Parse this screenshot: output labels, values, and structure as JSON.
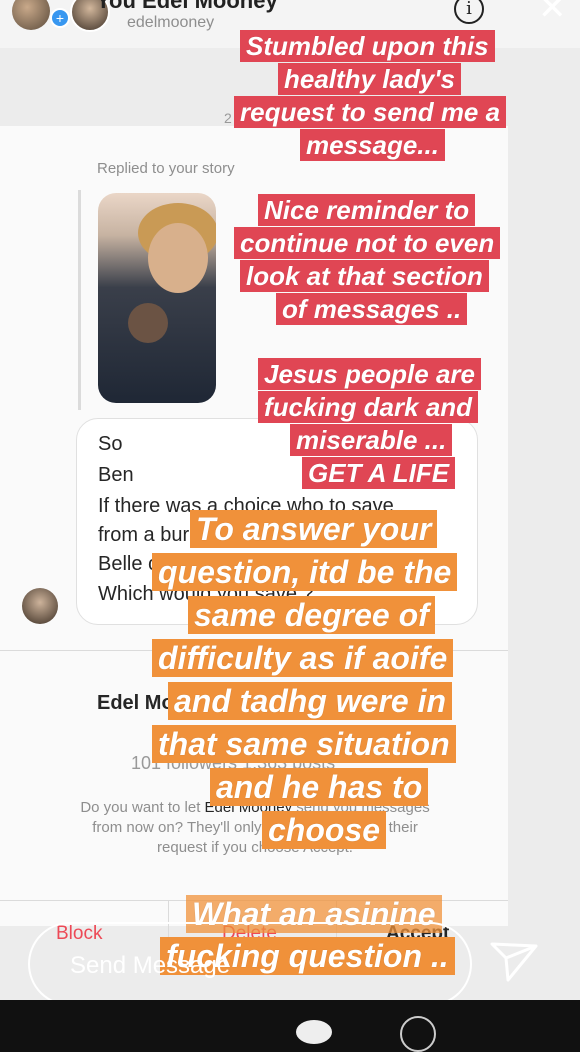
{
  "header": {
    "title": "You Edel Mooney",
    "handle": "edelmooney"
  },
  "dm": {
    "timestamp": "2",
    "replied_label": "Replied to your story",
    "message_lines": [
      "So",
      "Ben",
      "If there was a choice who to save",
      "from a bur",
      "Belle c",
      "Which would you save ?"
    ],
    "sender_name": "Edel Mo",
    "stats": "101 followers 1,363 posts",
    "prompt_line1_a": "Do you want to let ",
    "prompt_line1_name": "Edel Mooney",
    "prompt_line1_b": " send you messages",
    "prompt_line2": "from now on? They'll only know you've seen their",
    "prompt_line3": "request if you choose Accept.",
    "actions": {
      "block": "Block",
      "delete": "Delete",
      "accept": "Accept"
    }
  },
  "captions": {
    "red": [
      "Stumbled upon this",
      "healthy lady's",
      "request to send me a",
      "message...",
      "Nice reminder to",
      "continue not to even",
      "look at that section",
      "of messages ..",
      "Jesus people are",
      "fucking dark and",
      "miserable ...",
      "GET A LIFE"
    ],
    "orange": [
      "To answer your",
      "question, itd be the",
      "same degree of",
      "difficulty as if aoife",
      "and tadhg were in",
      "that same situation",
      "and he has to",
      "choose",
      "What an asinine",
      "fucking question .."
    ]
  },
  "reply": {
    "placeholder": "Send Message"
  },
  "colors": {
    "caption_red": "#e04654",
    "caption_orange": "#f0913a",
    "block_red": "#ed4956"
  },
  "icons": [
    "plus-badge-icon",
    "info-icon",
    "close-icon",
    "send-icon"
  ]
}
